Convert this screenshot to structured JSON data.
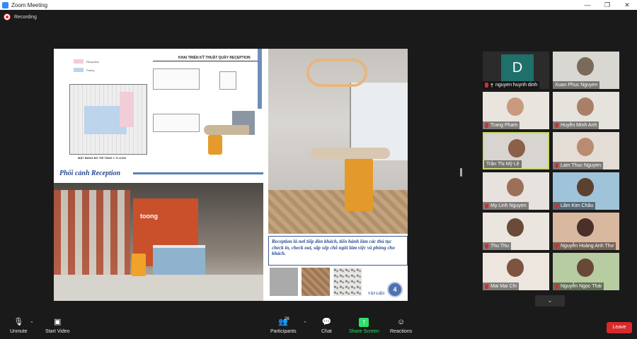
{
  "window": {
    "title": "Zoom Meeting",
    "controls": [
      "—",
      "❐",
      "✕"
    ]
  },
  "recording": {
    "label": "Recording"
  },
  "slide": {
    "drawing_title": "KHAI TRIỂN KỸ THUẬT QUẦY RECEPTION",
    "legend": [
      "Reception",
      "Pantry"
    ],
    "plan_caption": "MẶT BẰNG BỐ TRÍ TẦNG 1 TL1/100",
    "heading": "Phối cảnh Reception",
    "brand": "toong",
    "caption": "Reception là nơi tiếp đón khách, tiến hành làm các thủ tục check in, check out, sắp xếp chỗ ngồi làm việc và phòng cho khách.",
    "materials_label": "VẬT LIỆU",
    "page_number": "4"
  },
  "participants": [
    {
      "name": "nguyen huynh dinh",
      "initial": "D",
      "muted": true,
      "pinned": true,
      "selected": false
    },
    {
      "name": "Xuan Phuc Nguyen",
      "muted": false,
      "selected": false
    },
    {
      "name": "Trang Pham",
      "muted": true,
      "selected": false
    },
    {
      "name": "Huyền Minh Anh",
      "muted": true,
      "selected": false
    },
    {
      "name": "Trần Thị Mỹ Lệ",
      "muted": false,
      "selected": true
    },
    {
      "name": "Lam Thuc Nguyen",
      "muted": true,
      "selected": false
    },
    {
      "name": "My Linh Nguyen",
      "muted": true,
      "selected": false
    },
    {
      "name": "Lâm Kim Châu",
      "muted": true,
      "selected": false
    },
    {
      "name": "Thu Thu",
      "muted": true,
      "selected": false
    },
    {
      "name": "Nguyễn Hoàng Anh Thư",
      "muted": true,
      "selected": false
    },
    {
      "name": "Mai Mai Chi",
      "muted": true,
      "selected": false
    },
    {
      "name": "Nguyễn Ngọc Thái",
      "muted": true,
      "selected": false
    }
  ],
  "toolbar": {
    "unmute": "Unmute",
    "start_video": "Start Video",
    "participants": "Participants",
    "participants_count": "26",
    "chat": "Chat",
    "share_screen": "Share Screen",
    "reactions": "Reactions",
    "leave": "Leave"
  },
  "colors": {
    "accent": "#2d8cff",
    "leave": "#d72a2a",
    "share_green": "#2ee06a",
    "selected_border": "#c8d86b"
  }
}
